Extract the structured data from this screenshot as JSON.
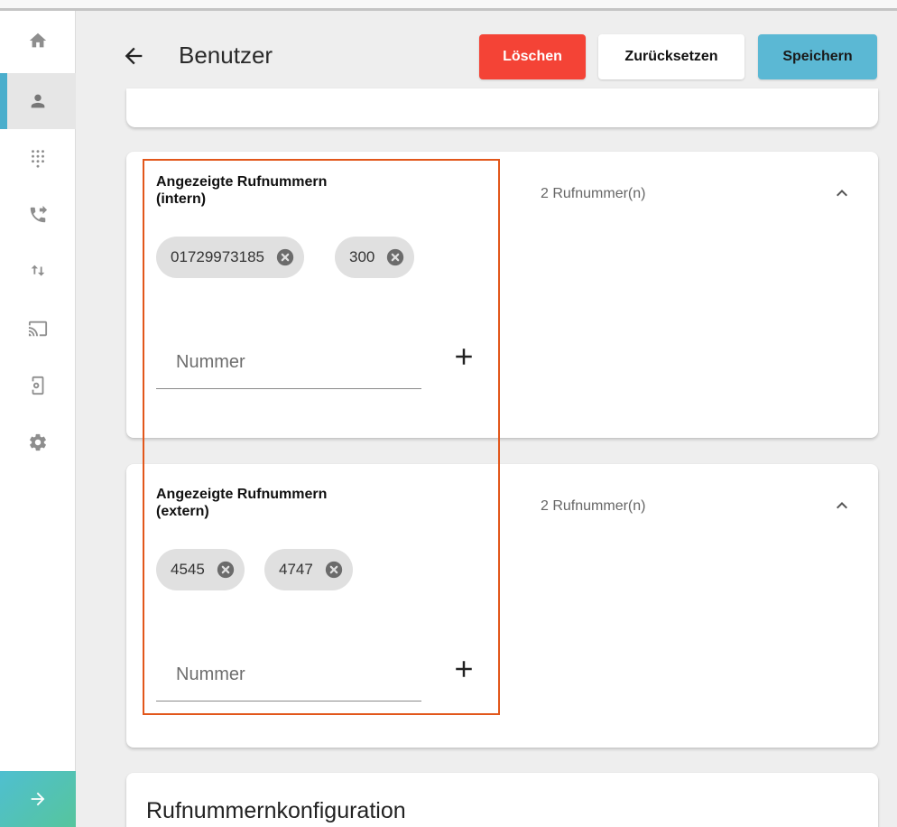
{
  "header": {
    "title": "Benutzer",
    "delete_label": "Löschen",
    "reset_label": "Zurücksetzen",
    "save_label": "Speichern"
  },
  "sidebar": {
    "items": [
      {
        "icon": "home-icon"
      },
      {
        "icon": "person-icon",
        "active": true
      },
      {
        "icon": "dialpad-icon"
      },
      {
        "icon": "phone-forward-icon"
      },
      {
        "icon": "swap-vert-icon"
      },
      {
        "icon": "cast-icon"
      },
      {
        "icon": "device-settings-icon"
      },
      {
        "icon": "gear-icon"
      }
    ],
    "collapse_icon": "arrow-forward-icon"
  },
  "intern": {
    "label": "Angezeigte Rufnummern (intern)",
    "count": "2 Rufnummer(n)",
    "chips": [
      "01729973185",
      "300"
    ],
    "input_placeholder": "Nummer",
    "input_value": ""
  },
  "extern": {
    "label": "Angezeigte Rufnummern (extern)",
    "count": "2 Rufnummer(n)",
    "chips": [
      "4545",
      "4747"
    ],
    "input_placeholder": "Nummer",
    "input_value": ""
  },
  "config": {
    "title": "Rufnummernkonfiguration"
  },
  "colors": {
    "accent": "#5bb8d4",
    "danger": "#f44336",
    "highlight": "#e2571b"
  }
}
